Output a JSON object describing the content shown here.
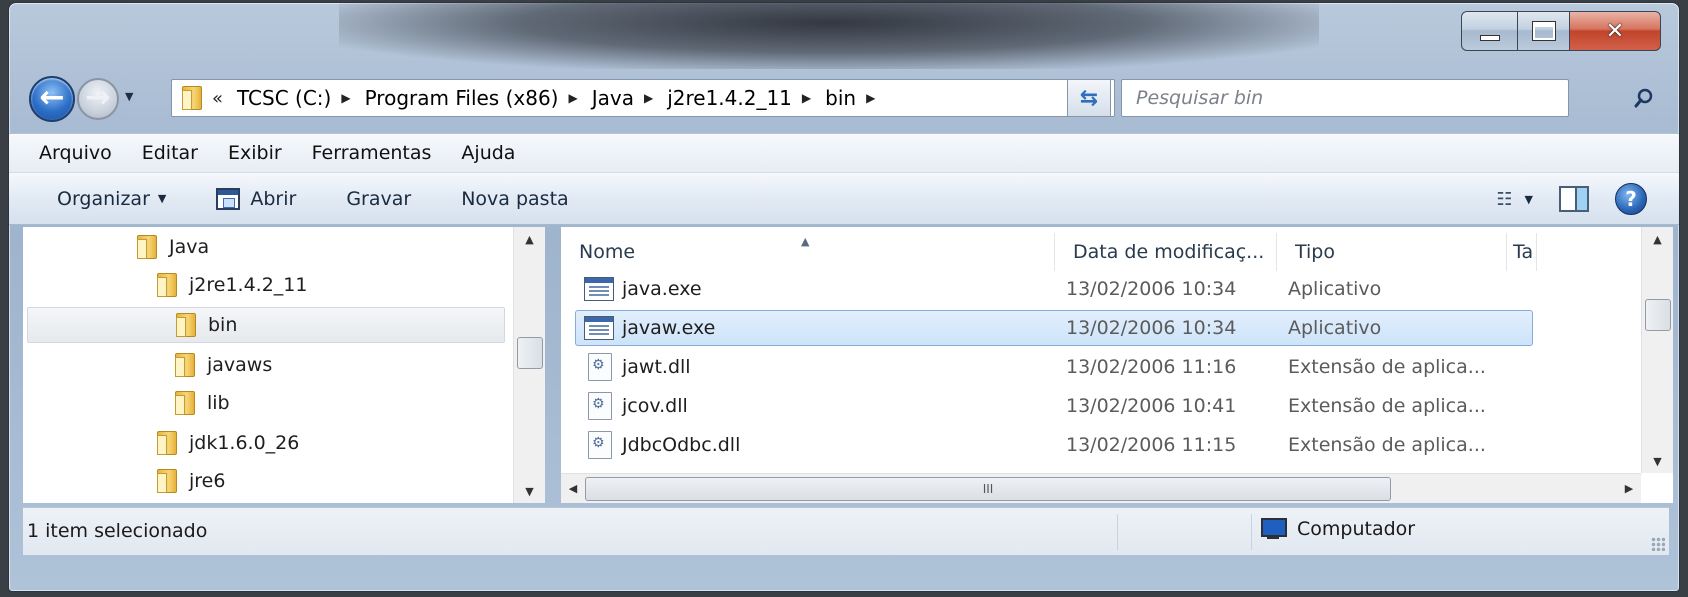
{
  "window": {
    "caption_buttons": {
      "minimize": "minimize",
      "maximize": "maximize",
      "close": "close"
    }
  },
  "address": {
    "more_label": "«",
    "breadcrumbs": [
      "TCSC (C:)",
      "Program Files (x86)",
      "Java",
      "j2re1.4.2_11",
      "bin"
    ]
  },
  "search": {
    "placeholder": "Pesquisar bin"
  },
  "menu": [
    "Arquivo",
    "Editar",
    "Exibir",
    "Ferramentas",
    "Ajuda"
  ],
  "toolbar": {
    "organize": "Organizar",
    "open": "Abrir",
    "burn": "Gravar",
    "new_folder": "Nova pasta"
  },
  "tree": [
    {
      "label": "Java",
      "indent": 0
    },
    {
      "label": "j2re1.4.2_11",
      "indent": 1
    },
    {
      "label": "bin",
      "indent": 2,
      "selected": true
    },
    {
      "label": "javaws",
      "indent": 2
    },
    {
      "label": "lib",
      "indent": 2
    },
    {
      "label": "jdk1.6.0_26",
      "indent": 1
    },
    {
      "label": "jre6",
      "indent": 1
    }
  ],
  "columns": {
    "name": "Nome",
    "date": "Data de modificaç...",
    "type": "Tipo",
    "size": "Ta"
  },
  "files": [
    {
      "name": "java.exe",
      "date": "13/02/2006 10:34",
      "type": "Aplicativo",
      "icon": "exe-icon"
    },
    {
      "name": "javaw.exe",
      "date": "13/02/2006 10:34",
      "type": "Aplicativo",
      "icon": "exe-icon",
      "selected": true
    },
    {
      "name": "jawt.dll",
      "date": "13/02/2006 11:16",
      "type": "Extensão de aplica...",
      "icon": "dll-icon"
    },
    {
      "name": "jcov.dll",
      "date": "13/02/2006 10:41",
      "type": "Extensão de aplica...",
      "icon": "dll-icon"
    },
    {
      "name": "JdbcOdbc.dll",
      "date": "13/02/2006 11:15",
      "type": "Extensão de aplica...",
      "icon": "dll-icon"
    }
  ],
  "hscroll_grip": "III",
  "status": {
    "selection": "1 item selecionado",
    "location": "Computador"
  },
  "colors": {
    "selection": "#cde3fa",
    "selection_border": "#84acdd",
    "frame": "#a9bcd3"
  }
}
